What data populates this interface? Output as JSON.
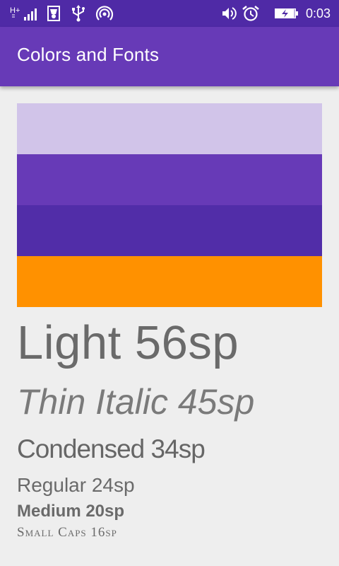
{
  "status_bar": {
    "time": "0:03",
    "network_label": "H+",
    "icons": [
      "signal-icon",
      "sim-icon",
      "usb-icon",
      "hotspot-icon",
      "volume-icon",
      "alarm-icon",
      "battery-charging-icon"
    ],
    "color": "#4f2aa6"
  },
  "app_bar": {
    "title": "Colors and Fonts",
    "color": "#673ab7"
  },
  "swatches": [
    {
      "name": "light-primary",
      "color": "#d1c4e9"
    },
    {
      "name": "primary",
      "color": "#673ab7"
    },
    {
      "name": "dark-primary",
      "color": "#512da8"
    },
    {
      "name": "accent",
      "color": "#ff9100"
    }
  ],
  "fonts": {
    "light": "Light 56sp",
    "thin_italic": "Thin Italic 45sp",
    "condensed": "Condensed 34sp",
    "regular": "Regular 24sp",
    "medium": "Medium 20sp",
    "small_caps": "Small Caps 16sp"
  }
}
